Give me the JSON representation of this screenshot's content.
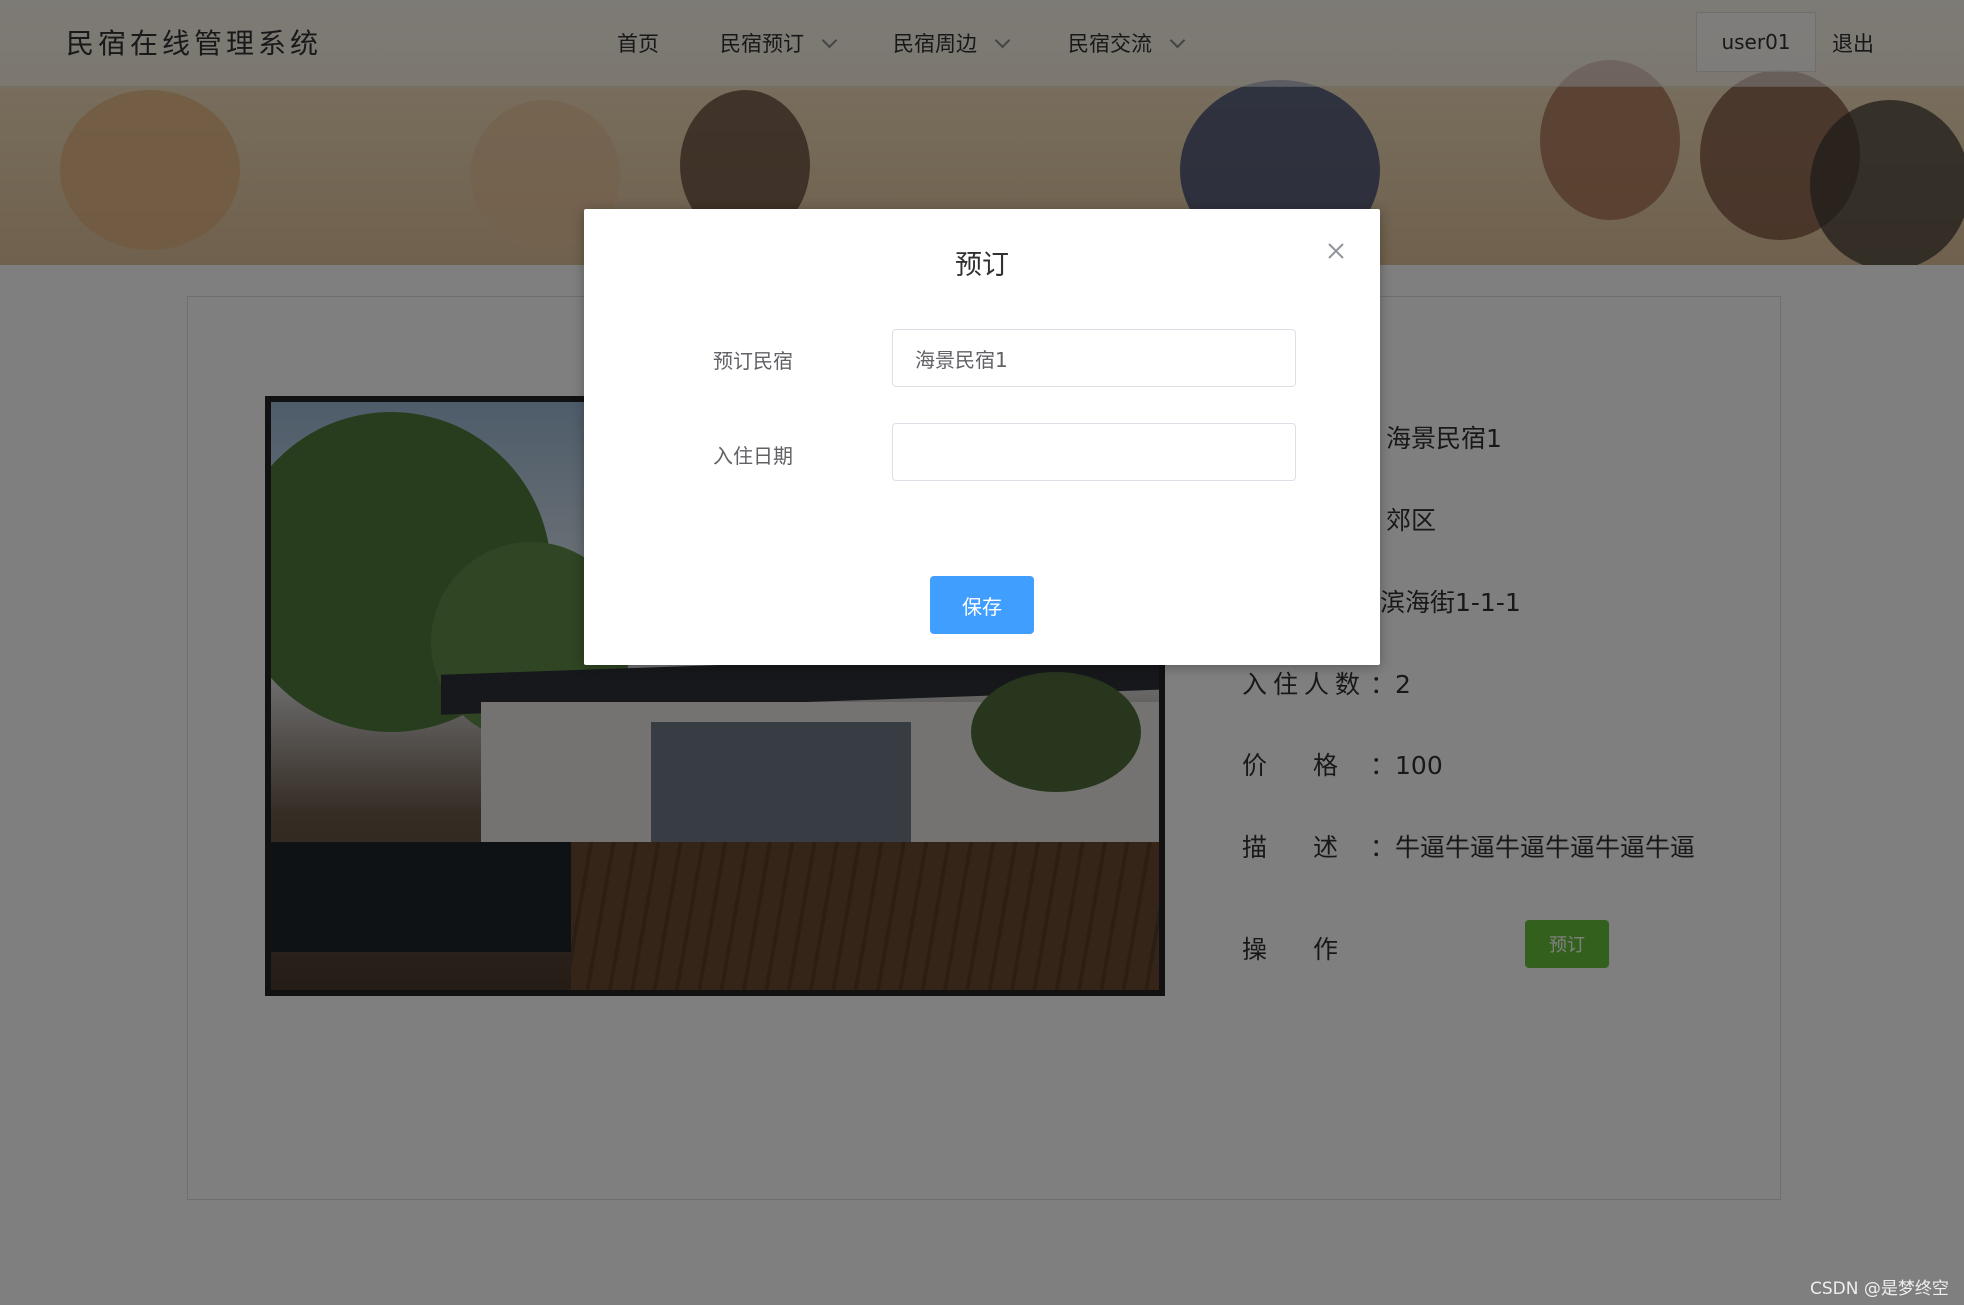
{
  "app": {
    "title": "民宿在线管理系统"
  },
  "nav": {
    "home": "首页",
    "booking": "民宿预订",
    "nearby": "民宿周边",
    "community": "民宿交流",
    "user": "user01",
    "logout": "退出"
  },
  "detail": {
    "name_value": "海景民宿1",
    "area_value": "郊区",
    "address_value": "滨海街1-1-1",
    "guests_label": "入住人数",
    "guests_value": "2",
    "price_label": "价格",
    "price_value": "100",
    "desc_label": "描述",
    "desc_value": "牛逼牛逼牛逼牛逼牛逼牛逼",
    "action_label": "操作",
    "book_button": "预订",
    "sep": "："
  },
  "dialog": {
    "title": "预订",
    "field_homestay_label": "预订民宿",
    "field_homestay_value": "海景民宿1",
    "field_date_label": "入住日期",
    "field_date_value": "",
    "save_button": "保存"
  },
  "watermark": "CSDN @是梦终空",
  "colors": {
    "primary": "#409eff",
    "success": "#67c23a",
    "overlay": "rgba(0,0,0,0.5)"
  }
}
